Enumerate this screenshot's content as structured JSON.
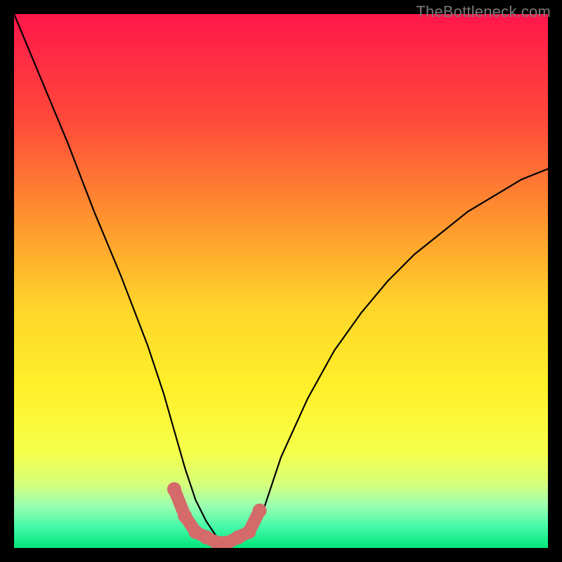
{
  "watermark": {
    "text": "TheBottleneck.com"
  },
  "chart_data": {
    "type": "line",
    "title": "",
    "xlabel": "",
    "ylabel": "",
    "xlim": [
      0,
      100
    ],
    "ylim": [
      0,
      100
    ],
    "grid": false,
    "legend": false,
    "series": [
      {
        "name": "black-curve",
        "color": "#000000",
        "x": [
          0,
          5,
          10,
          15,
          20,
          25,
          28,
          30,
          32,
          34,
          36,
          38,
          40,
          42,
          44,
          46,
          48,
          50,
          55,
          60,
          65,
          70,
          75,
          80,
          85,
          90,
          95,
          100
        ],
        "values": [
          100,
          88,
          76,
          63,
          51,
          38,
          29,
          22,
          15,
          9,
          5,
          2,
          1,
          1,
          2,
          5,
          11,
          17,
          28,
          37,
          44,
          50,
          55,
          59,
          63,
          66,
          69,
          71
        ]
      },
      {
        "name": "marker-band",
        "color": "#d46a6a",
        "x": [
          30,
          32,
          34,
          36,
          38,
          40,
          42,
          44,
          46
        ],
        "values": [
          11,
          6,
          3,
          2,
          1,
          1,
          2,
          3,
          7
        ]
      }
    ],
    "background_gradient": {
      "type": "vertical",
      "stops": [
        {
          "pos": 0.0,
          "color": "#ff164b"
        },
        {
          "pos": 0.2,
          "color": "#ff4a3a"
        },
        {
          "pos": 0.4,
          "color": "#ff9a2e"
        },
        {
          "pos": 0.55,
          "color": "#ffd52a"
        },
        {
          "pos": 0.7,
          "color": "#fff02a"
        },
        {
          "pos": 0.82,
          "color": "#f6ff4a"
        },
        {
          "pos": 0.88,
          "color": "#d6ff7a"
        },
        {
          "pos": 0.92,
          "color": "#9cffb0"
        },
        {
          "pos": 0.96,
          "color": "#46f9a8"
        },
        {
          "pos": 1.0,
          "color": "#00e67a"
        }
      ]
    }
  }
}
